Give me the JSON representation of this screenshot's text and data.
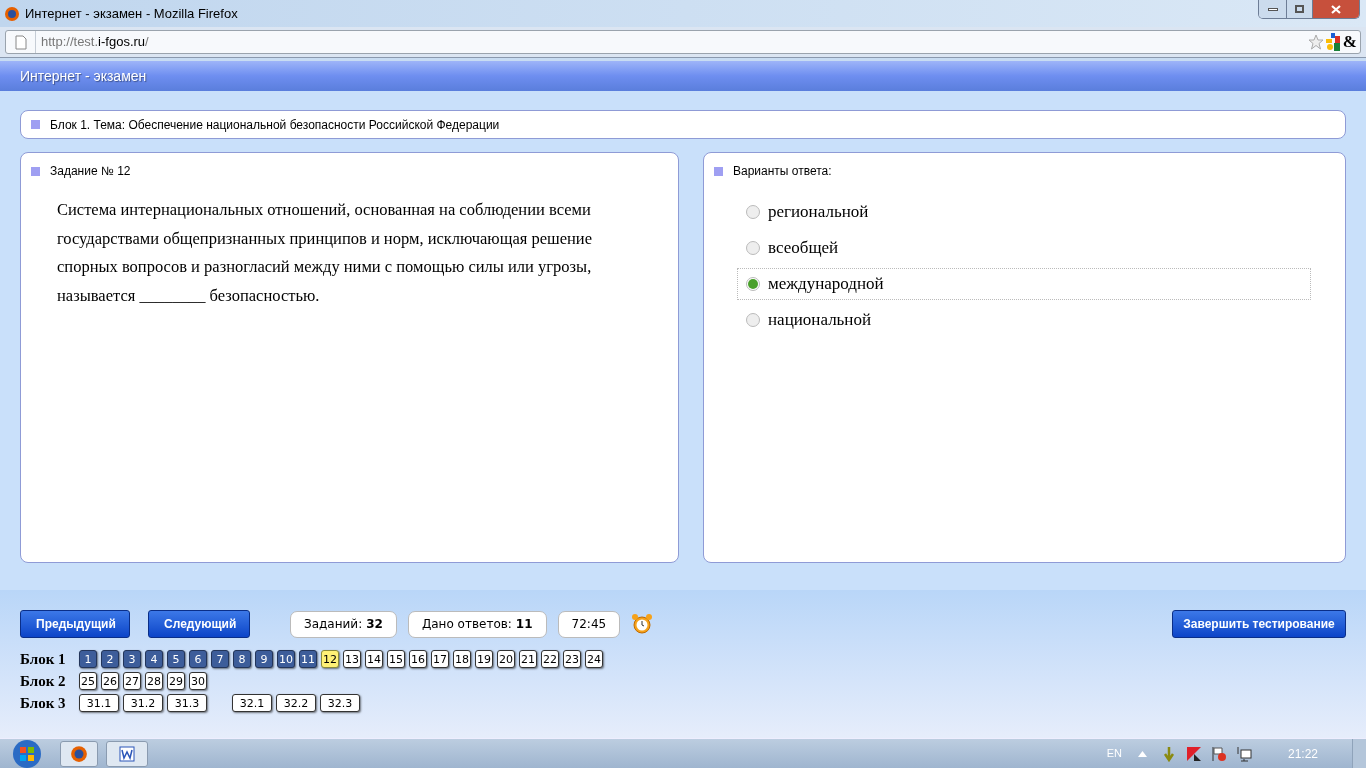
{
  "window": {
    "title": "Интернет - экзамен - Mozilla Firefox"
  },
  "address_bar": {
    "url_prefix": "http://test.",
    "url_domain": "i-fgos.ru",
    "url_suffix": "/",
    "addon_glyph": "&"
  },
  "header": {
    "title": "Интернет - экзамен"
  },
  "block_title": "Блок 1. Тема: Обеспечение национальной безопасности Российской Федерации",
  "question": {
    "heading": "Задание № 12",
    "text": "Система интернациональных отношений, основанная на соблюдении всеми государствами общепризнанных принципов и норм, исключающая решение спорных вопросов и разногласий между ними с помощью силы или угрозы, называется ________ безопасностью."
  },
  "answers": {
    "heading": "Варианты ответа:",
    "options": [
      {
        "label": "региональной",
        "selected": false
      },
      {
        "label": "всеобщей",
        "selected": false
      },
      {
        "label": "международной",
        "selected": true
      },
      {
        "label": "национальной",
        "selected": false
      }
    ]
  },
  "nav": {
    "prev": "Предыдущий",
    "next": "Следующий",
    "finish": "Завершить тестирование"
  },
  "stats": [
    {
      "label": "Заданий:",
      "value": "32"
    },
    {
      "label": "Дано ответов:",
      "value": "11"
    },
    {
      "value": "72:45"
    }
  ],
  "blocks": [
    {
      "label": "Блок 1",
      "groups": [
        [
          {
            "n": "1",
            "answered": true,
            "selected": false
          },
          {
            "n": "2",
            "answered": true,
            "selected": false
          },
          {
            "n": "3",
            "answered": true,
            "selected": false
          },
          {
            "n": "4",
            "answered": true,
            "selected": false
          },
          {
            "n": "5",
            "answered": true,
            "selected": false
          },
          {
            "n": "6",
            "answered": true,
            "selected": false
          },
          {
            "n": "7",
            "answered": true,
            "selected": false
          },
          {
            "n": "8",
            "answered": true,
            "selected": false
          },
          {
            "n": "9",
            "answered": true,
            "selected": false
          },
          {
            "n": "10",
            "answered": true,
            "selected": false
          },
          {
            "n": "11",
            "answered": true,
            "selected": false
          },
          {
            "n": "12",
            "answered": false,
            "selected": true
          },
          {
            "n": "13",
            "answered": false,
            "selected": false
          },
          {
            "n": "14",
            "answered": false,
            "selected": false
          },
          {
            "n": "15",
            "answered": false,
            "selected": false
          },
          {
            "n": "16",
            "answered": false,
            "selected": false
          },
          {
            "n": "17",
            "answered": false,
            "selected": false
          },
          {
            "n": "18",
            "answered": false,
            "selected": false
          },
          {
            "n": "19",
            "answered": false,
            "selected": false
          },
          {
            "n": "20",
            "answered": false,
            "selected": false
          },
          {
            "n": "21",
            "answered": false,
            "selected": false
          },
          {
            "n": "22",
            "answered": false,
            "selected": false
          },
          {
            "n": "23",
            "answered": false,
            "selected": false
          },
          {
            "n": "24",
            "answered": false,
            "selected": false
          }
        ]
      ]
    },
    {
      "label": "Блок 2",
      "groups": [
        [
          {
            "n": "25",
            "answered": false,
            "selected": false
          },
          {
            "n": "26",
            "answered": false,
            "selected": false
          },
          {
            "n": "27",
            "answered": false,
            "selected": false
          },
          {
            "n": "28",
            "answered": false,
            "selected": false
          },
          {
            "n": "29",
            "answered": false,
            "selected": false
          },
          {
            "n": "30",
            "answered": false,
            "selected": false
          }
        ]
      ]
    },
    {
      "label": "Блок 3",
      "groups": [
        [
          {
            "n": "31.1",
            "answered": false,
            "selected": false
          },
          {
            "n": "31.2",
            "answered": false,
            "selected": false
          },
          {
            "n": "31.3",
            "answered": false,
            "selected": false
          }
        ],
        [
          {
            "n": "32.1",
            "answered": false,
            "selected": false
          },
          {
            "n": "32.2",
            "answered": false,
            "selected": false
          },
          {
            "n": "32.3",
            "answered": false,
            "selected": false
          }
        ]
      ]
    }
  ],
  "taskbar": {
    "language": "EN",
    "clock": "21:22"
  }
}
